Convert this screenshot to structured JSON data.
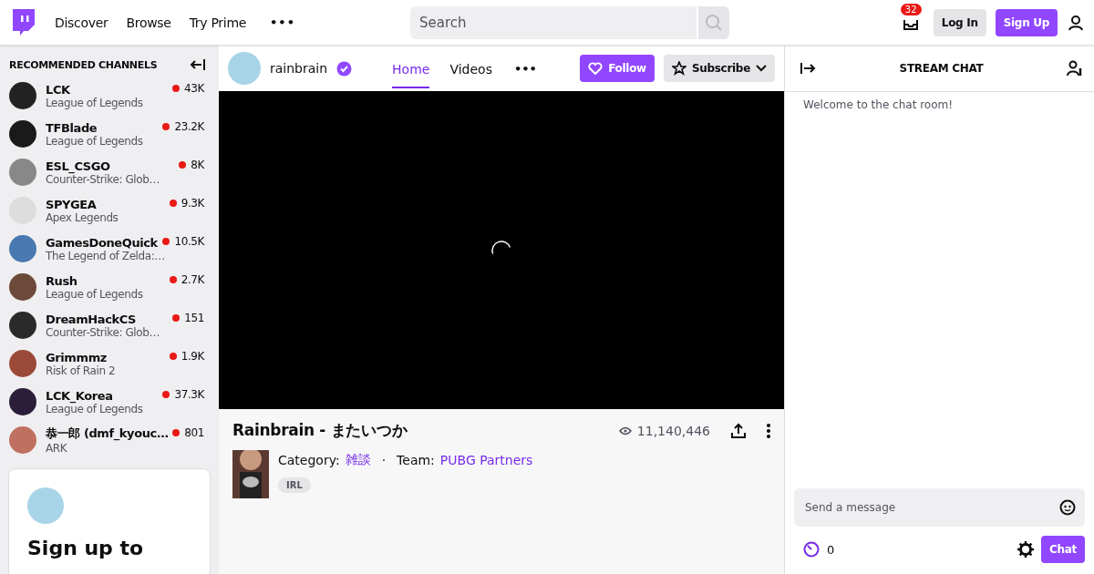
{
  "nav": {
    "links": [
      "Discover",
      "Browse",
      "Try Prime"
    ],
    "more": "•••",
    "search": {
      "placeholder": "Search"
    },
    "inbox_badge": "32",
    "login": "Log In",
    "signup": "Sign Up"
  },
  "sidebar": {
    "title": "RECOMMENDED CHANNELS",
    "channels": [
      {
        "name": "LCK",
        "game": "League of Legends",
        "viewers": "43K"
      },
      {
        "name": "TFBlade",
        "game": "League of Legends",
        "viewers": "23.2K"
      },
      {
        "name": "ESL_CSGO",
        "game": "Counter-Strike: Glob…",
        "viewers": "8K"
      },
      {
        "name": "SPYGEA",
        "game": "Apex Legends",
        "viewers": "9.3K"
      },
      {
        "name": "GamesDoneQuick",
        "game": "The Legend of Zelda:…",
        "viewers": "10.5K"
      },
      {
        "name": "Rush",
        "game": "League of Legends",
        "viewers": "2.7K"
      },
      {
        "name": "DreamHackCS",
        "game": "Counter-Strike: Glob…",
        "viewers": "151"
      },
      {
        "name": "Grimmmz",
        "game": "Risk of Rain 2",
        "viewers": "1.9K"
      },
      {
        "name": "LCK_Korea",
        "game": "League of Legends",
        "viewers": "37.3K"
      },
      {
        "name": "恭一郎 (dmf_kyouc…",
        "game": "ARK",
        "viewers": "801"
      }
    ],
    "signup_card": {
      "heading": "Sign up to"
    }
  },
  "channel": {
    "name": "rainbrain",
    "verified": true,
    "tabs": [
      {
        "label": "Home",
        "selected": true
      },
      {
        "label": "Videos",
        "selected": false
      }
    ],
    "more": "•••",
    "follow": "Follow",
    "subscribe": "Subscribe"
  },
  "stream": {
    "title": "Rainbrain - またいつか",
    "views": "11,140,446",
    "category_label": "Category:",
    "category": "雑談",
    "separator": "·",
    "team_label": "Team:",
    "team": "PUBG Partners",
    "tags": [
      "IRL"
    ]
  },
  "chat": {
    "title": "STREAM CHAT",
    "welcome": "Welcome to the chat room!",
    "placeholder": "Send a message",
    "points": "0",
    "send": "Chat"
  }
}
